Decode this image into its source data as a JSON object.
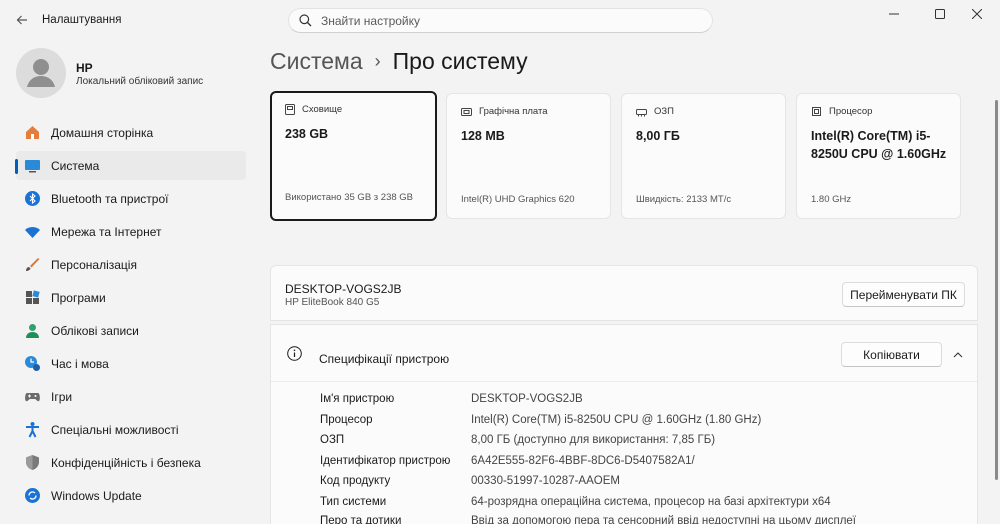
{
  "window": {
    "app_title": "Налаштування",
    "search_placeholder": "Знайти настройку"
  },
  "profile": {
    "name": "HP",
    "account_type": "Локальний обліковий запис"
  },
  "sidebar": {
    "items": [
      {
        "label": "Домашня сторінка",
        "icon": "home-icon",
        "active": false
      },
      {
        "label": "Система",
        "icon": "system-icon",
        "active": true
      },
      {
        "label": "Bluetooth та пристрої",
        "icon": "bluetooth-icon",
        "active": false
      },
      {
        "label": "Мережа та Інтернет",
        "icon": "wifi-icon",
        "active": false
      },
      {
        "label": "Персоналізація",
        "icon": "brush-icon",
        "active": false
      },
      {
        "label": "Програми",
        "icon": "apps-icon",
        "active": false
      },
      {
        "label": "Облікові записи",
        "icon": "accounts-icon",
        "active": false
      },
      {
        "label": "Час і мова",
        "icon": "time-language-icon",
        "active": false
      },
      {
        "label": "Ігри",
        "icon": "gaming-icon",
        "active": false
      },
      {
        "label": "Спеціальні можливості",
        "icon": "accessibility-icon",
        "active": false
      },
      {
        "label": "Конфіденційність і безпека",
        "icon": "shield-icon",
        "active": false
      },
      {
        "label": "Windows Update",
        "icon": "update-icon",
        "active": false
      }
    ]
  },
  "breadcrumb": {
    "parent": "Система",
    "current": "Про систему"
  },
  "cards": [
    {
      "label": "Сховище",
      "value": "238 GB",
      "footer": "Використано 35 GB з 238 GB",
      "icon": "storage-icon"
    },
    {
      "label": "Графічна плата",
      "value": "128 MB",
      "footer": "Intel(R) UHD Graphics 620",
      "icon": "gpu-icon"
    },
    {
      "label": "ОЗП",
      "value": "8,00 ГБ",
      "footer": "Швидкість: 2133 МТ/с",
      "icon": "ram-icon"
    },
    {
      "label": "Процесор",
      "value": "Intel(R) Core(TM) i5-8250U CPU @ 1.60GHz",
      "footer": "1.80 GHz",
      "icon": "cpu-icon"
    }
  ],
  "device": {
    "name": "DESKTOP-VOGS2JB",
    "model": "HP EliteBook 840 G5",
    "rename_label": "Перейменувати ПК"
  },
  "specs": {
    "title": "Специфікації пристрою",
    "copy_label": "Копіювати",
    "rows": [
      {
        "key": "Ім'я пристрою",
        "value": "DESKTOP-VOGS2JB"
      },
      {
        "key": "Процесор",
        "value": "Intel(R) Core(TM) i5-8250U CPU @ 1.60GHz (1.80 GHz)"
      },
      {
        "key": "ОЗП",
        "value": "8,00 ГБ (доступно для використання: 7,85 ГБ)"
      },
      {
        "key": "Ідентифікатор пристрою",
        "value": "6A42E555-82F6-4BBF-8DC6-D5407582A1/"
      },
      {
        "key": "Код продукту",
        "value": "00330-51997-10287-AAOEM"
      },
      {
        "key": "Тип системи",
        "value": "64-розрядна операційна система, процесор на базі архітектури x64"
      },
      {
        "key": "Перо та дотики",
        "value": "Ввід за допомогою пера та сенсорний ввід недоступні на цьому дисплеї"
      }
    ]
  },
  "colors": {
    "accent": "#005fb8",
    "background": "#f3f3f3"
  }
}
